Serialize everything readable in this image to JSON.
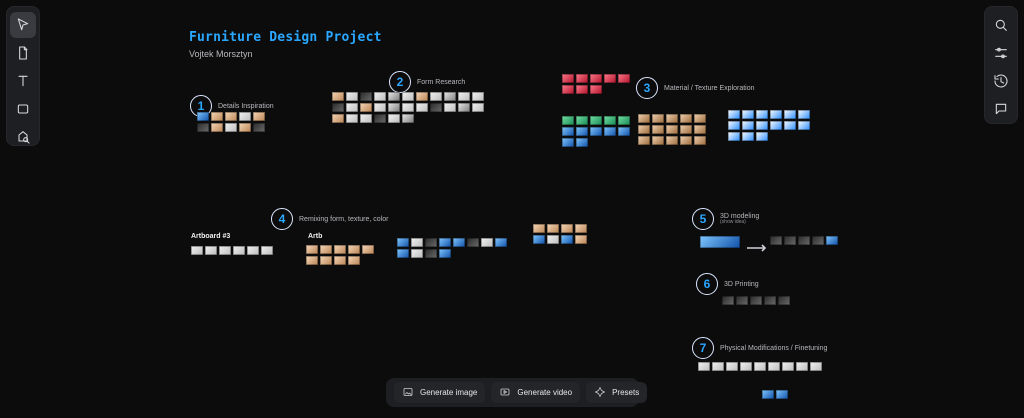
{
  "header": {
    "title": "Furniture Design Project",
    "subtitle": "Vojtek Morsztyn"
  },
  "left_toolbar": {
    "tools": [
      {
        "icon": "select-arrow-icon",
        "active": true
      },
      {
        "icon": "document-plus-icon",
        "active": false
      },
      {
        "icon": "text-tool-icon",
        "active": false
      },
      {
        "icon": "rectangle-tool-icon",
        "active": false
      },
      {
        "icon": "shapes-search-icon",
        "active": false
      }
    ]
  },
  "right_toolbar": {
    "tools": [
      {
        "icon": "search-icon"
      },
      {
        "icon": "adjustments-icon"
      },
      {
        "icon": "history-icon"
      },
      {
        "icon": "comment-icon"
      }
    ]
  },
  "sections": [
    {
      "number": "1",
      "label": "Details Inspiration"
    },
    {
      "number": "2",
      "label": "Form Research"
    },
    {
      "number": "3",
      "label": "Material / Texture Exploration"
    },
    {
      "number": "4",
      "label": "Remixing form, texture, color"
    },
    {
      "number": "5",
      "label": "3D modeling",
      "sublabel": "(show idea)"
    },
    {
      "number": "6",
      "label": "3D Printing"
    },
    {
      "number": "7",
      "label": "Physical Modifications / Finetuning"
    }
  ],
  "artboards": [
    {
      "label": "Artboard #3"
    },
    {
      "label": "Artb"
    }
  ],
  "bottom_bar": {
    "buttons": [
      {
        "label": "Generate image",
        "icon": "image-icon"
      },
      {
        "label": "Generate video",
        "icon": "video-icon"
      },
      {
        "label": "Presets",
        "icon": "presets-icon"
      }
    ]
  },
  "colors": {
    "accent": "#2aa7ff",
    "background": "#0c0c0d",
    "panel": "#1e1f22"
  }
}
